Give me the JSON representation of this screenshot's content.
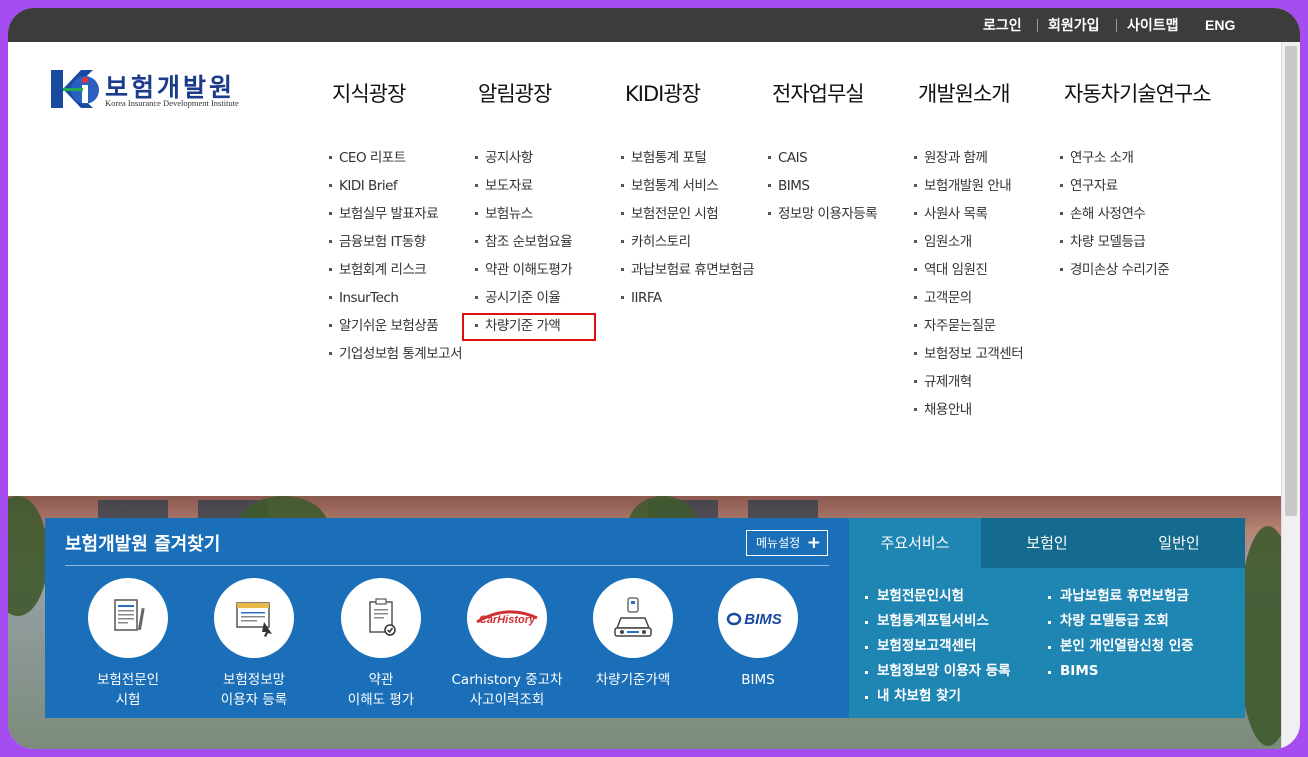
{
  "topbar": {
    "login": "로그인",
    "signup": "회원가입",
    "sitemap": "사이트맵",
    "eng": "ENG"
  },
  "logo": {
    "name_ko": "보험개발원",
    "name_en": "Korea Insurance Development Institute"
  },
  "nav": [
    {
      "title": "지식광장",
      "items": [
        "CEO 리포트",
        "KIDI Brief",
        "보험실무 발표자료",
        "금융보험 IT동향",
        "보험회계 리스크",
        "InsurTech",
        "알기쉬운 보험상품",
        "기업성보험 통계보고서"
      ]
    },
    {
      "title": "알림광장",
      "items": [
        "공지사항",
        "보도자료",
        "보험뉴스",
        "참조 순보험요율",
        "약관 이해도평가",
        "공시기준 이율",
        "차량기준 가액"
      ]
    },
    {
      "title": "KIDI광장",
      "items": [
        "보험통계 포털",
        "보험통계 서비스",
        "보험전문인 시험",
        "카히스토리",
        "과납보험료 휴면보험금",
        "IIRFA"
      ]
    },
    {
      "title": "전자업무실",
      "items": [
        "CAIS",
        "BIMS",
        "정보망 이용자등록"
      ]
    },
    {
      "title": "개발원소개",
      "items": [
        "원장과 함께",
        "보험개발원 안내",
        "사원사 목록",
        "임원소개",
        "역대 임원진",
        "고객문의",
        "자주묻는질문",
        "보험정보 고객센터",
        "규제개혁",
        "채용안내"
      ]
    },
    {
      "title": "자동차기술연구소",
      "items": [
        "연구소 소개",
        "연구자료",
        "손해 사정연수",
        "차량 모델등급",
        "경미손상 수리기준"
      ]
    }
  ],
  "favorites": {
    "title": "보험개발원 즐겨찾기",
    "setting_label": "메뉴설정",
    "items": [
      {
        "label": "보험전문인\n시험",
        "icon": "document-pen-icon"
      },
      {
        "label": "보험정보망\n이용자 등록",
        "icon": "monitor-cursor-icon"
      },
      {
        "label": "약관\n이해도 평가",
        "icon": "clipboard-check-icon"
      },
      {
        "label": "Carhistory 중고차\n사고이력조회",
        "icon": "carhistory-logo",
        "logo_text": "CarHistory"
      },
      {
        "label": "차량기준가액",
        "icon": "car-price-icon"
      },
      {
        "label": "BIMS",
        "icon": "bims-logo",
        "logo_text": "BIMS"
      }
    ]
  },
  "services": {
    "tabs": [
      "주요서비스",
      "보험인",
      "일반인"
    ],
    "active_tab": "주요서비스",
    "col1": [
      "보험전문인시험",
      "보험통계포털서비스",
      "보험정보고객센터",
      "보험정보망 이용자 등록",
      "내 차보험 찾기"
    ],
    "col2": [
      "과납보험료 휴면보험금",
      "차량 모델등급 조회",
      "본인 개인열람신청 인증",
      "BIMS"
    ]
  },
  "colors": {
    "frame": "#a54df0",
    "topbar": "#3c3c3c",
    "favorites_panel": "#1a6fb8",
    "services_panel": "#1f86b3",
    "highlight": "#e01010"
  }
}
